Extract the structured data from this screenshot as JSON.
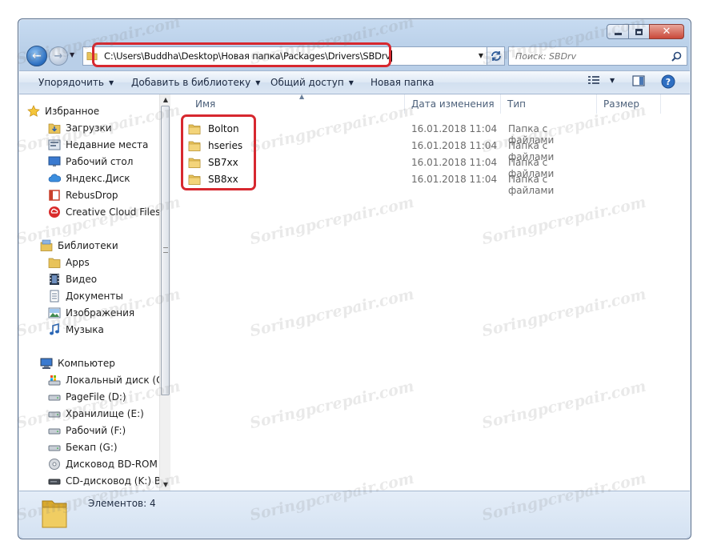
{
  "address_bar": {
    "path": "C:\\Users\\Buddha\\Desktop\\Новая папка\\Packages\\Drivers\\SBDrv"
  },
  "search": {
    "placeholder": "Поиск: SBDrv"
  },
  "toolbar": {
    "organize": "Упорядочить",
    "add_to_library": "Добавить в библиотеку",
    "share": "Общий доступ",
    "new_folder": "Новая папка"
  },
  "navigation": {
    "favorites": {
      "label": "Избранное",
      "items": [
        "Загрузки",
        "Недавние места",
        "Рабочий стол",
        "Яндекс.Диск",
        "RebusDrop",
        "Creative Cloud Files"
      ]
    },
    "libraries": {
      "label": "Библиотеки",
      "items": [
        "Apps",
        "Видео",
        "Документы",
        "Изображения",
        "Музыка"
      ]
    },
    "computer": {
      "label": "Компьютер",
      "items": [
        "Локальный диск (C:)",
        "PageFile (D:)",
        "Хранилище (E:)",
        "Рабочий (F:)",
        "Бекап (G:)",
        "Дисковод BD-ROM (I",
        "CD-дисковод (K:) Bee"
      ]
    }
  },
  "columns": {
    "name": "Имя",
    "date": "Дата изменения",
    "type": "Тип",
    "size": "Размер"
  },
  "files": [
    {
      "name": "Bolton",
      "date": "16.01.2018 11:04",
      "type": "Папка с файлами"
    },
    {
      "name": "hseries",
      "date": "16.01.2018 11:04",
      "type": "Папка с файлами"
    },
    {
      "name": "SB7xx",
      "date": "16.01.2018 11:04",
      "type": "Папка с файлами"
    },
    {
      "name": "SB8xx",
      "date": "16.01.2018 11:04",
      "type": "Папка с файлами"
    }
  ],
  "status": {
    "items_count": "Элементов: 4"
  },
  "watermark": "Soringpcrepair.com",
  "colors": {
    "highlight": "#d7282f",
    "folder": "#e8c35a"
  }
}
